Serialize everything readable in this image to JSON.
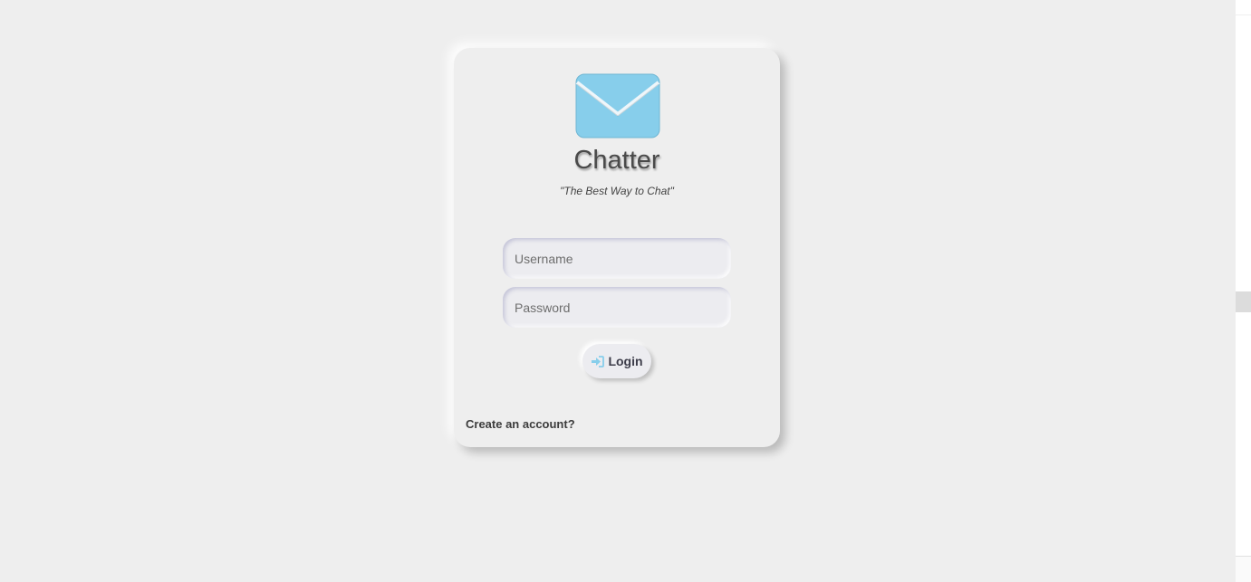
{
  "app": {
    "name": "Chatter",
    "tagline": "\"The Best Way to Chat\"",
    "logo_icon": "envelope-icon",
    "accent_color": "#87ceeb"
  },
  "login_form": {
    "username_placeholder": "Username",
    "password_placeholder": "Password",
    "login_label": "Login",
    "login_icon": "sign-in-icon",
    "create_account_label": "Create an account?"
  }
}
